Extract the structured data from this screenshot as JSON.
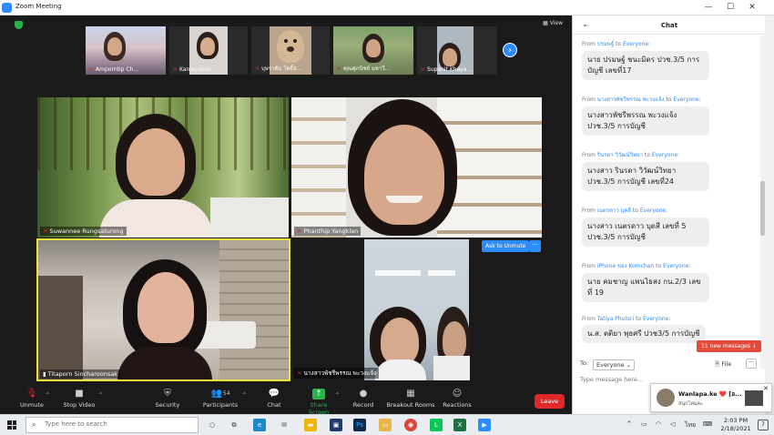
{
  "window": {
    "title": "Zoom Meeting",
    "view_label": "View"
  },
  "strip": {
    "participants": [
      {
        "name": "Amporntip Ch..."
      },
      {
        "name": "Kanlayakan"
      },
      {
        "name": "บุษราคัม โพธิ์ส..."
      },
      {
        "name": "คุณศุภนิชย์ มหาวี..."
      },
      {
        "name": "Supanit Khaya..."
      }
    ],
    "next_arrow": "›"
  },
  "gallery": {
    "tiles": [
      {
        "name": "Suwannee Rungsaturong"
      },
      {
        "name": "Phanthip Yangklan"
      },
      {
        "name": "Titaporn Sincharoonsak"
      },
      {
        "name": "นางสาวพัชรีพรรณ พะวงแจ้ง"
      }
    ],
    "ask_to_unmute": "Ask to Unmute",
    "more": "···"
  },
  "toolbar": {
    "unmute": "Unmute",
    "stop_video": "Stop Video",
    "security": "Security",
    "participants": "Participants",
    "participants_count": "54",
    "chat": "Chat",
    "share_screen": "Share Screen",
    "record": "Record",
    "breakout_rooms": "Breakout Rooms",
    "reactions": "Reactions",
    "leave": "Leave"
  },
  "chat": {
    "title": "Chat",
    "messages": [
      {
        "from": "ปรมษฐ์",
        "to": "Everyone",
        "text": "นาย ปรมษฐ์ ชนะมิตร ปวช.3/5 การบัญชี เลขที่17"
      },
      {
        "from": "นางสาวพัชรีพรรณ พะวงแจ้ง",
        "to": "Everyone",
        "text": "นางสาวพัชรีพรรณ พะวงแจ้ง ปวช.3/5 การบัญชี"
      },
      {
        "from": "รินรดา วิวัฒน์วิทยา",
        "to": "Everyone",
        "text": "นางสาว รินรดา วิวัฒน์วิทยา ปวช.3/5 การบัญชี เลขที่24"
      },
      {
        "from": "เนตรดาว บุดสี",
        "to": "Everyone",
        "text": "นางสาว เนตรดาว บุดสี เลขที่ 5 ปวช.3/5 การบัญชี"
      },
      {
        "from": "iPhone ของ Komchan",
        "to": "Everyone",
        "text": "นาย คมชาญ แพนไธสง กน.2/3 เลขที่ 19"
      },
      {
        "from": "Tatiya Phutsri",
        "to": "Everyone",
        "text": "น.ส. ตติยา พุธศรี ปวช3/5 การบัญชี"
      }
    ],
    "from_label": "From",
    "to_label": "to",
    "new_messages": "11 new messages ↓",
    "to_prefix": "To:",
    "recipient": "Everyone",
    "file_label": "File",
    "more": "···",
    "input_placeholder": "Type message here..."
  },
  "notification": {
    "name": "Wanlapa.ke ❤️ [อ...",
    "subtitle": "สนุกไหมคะ",
    "close": "✕"
  },
  "taskbar": {
    "search_placeholder": "Type here to search",
    "time": "2:03 PM",
    "date": "2/18/2021",
    "language": "ไทย",
    "notifications_count": "7"
  },
  "colors": {
    "accent": "#2d8cff",
    "leave": "#e02828",
    "active_speaker": "#e8e23a",
    "new_messages": "#e64a3a",
    "share": "#2bb24c"
  }
}
